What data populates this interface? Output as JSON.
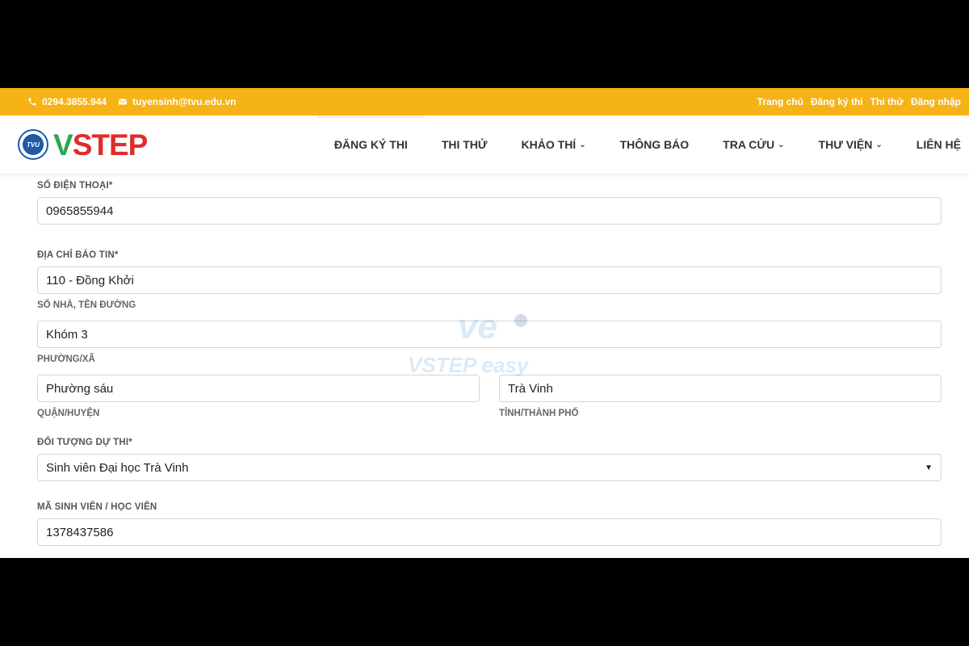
{
  "topbar": {
    "phone": "0294.3855.944",
    "email": "tuyensinh@tvu.edu.vn",
    "links": [
      "Trang chủ",
      "Đăng ký thi",
      "Thi thử",
      "Đăng nhập"
    ]
  },
  "header": {
    "logo_seal_text": "TVU",
    "brand_v": "V",
    "brand_rest": "STEP",
    "nav": [
      {
        "label": "ĐĂNG KÝ THI",
        "dropdown": false
      },
      {
        "label": "THI THỬ",
        "dropdown": false
      },
      {
        "label": "KHẢO THÍ",
        "dropdown": true
      },
      {
        "label": "THÔNG BÁO",
        "dropdown": false
      },
      {
        "label": "TRA CỨU",
        "dropdown": true
      },
      {
        "label": "THƯ VIỆN",
        "dropdown": true
      },
      {
        "label": "LIÊN HỆ",
        "dropdown": false
      }
    ]
  },
  "form": {
    "phone_label": "SỐ ĐIỆN THOẠI*",
    "phone_value": "0965855944",
    "address_label": "ĐỊA CHỈ BÁO TIN*",
    "street_value": "110 - Đồng Khởi",
    "street_hint": "SỐ NHÀ, TÊN ĐƯỜNG",
    "ward_value": "Khóm 3",
    "ward_hint": "PHƯỜNG/XÃ",
    "district_value": "Phường sáu",
    "district_hint": "QUẬN/HUYỆN",
    "province_value": "Trà Vinh",
    "province_hint": "TỈNH/THÀNH PHỐ",
    "candidate_label": "ĐỐI TƯỢNG DỰ THI*",
    "candidate_value": "Sinh viên Đại học Trà Vinh",
    "student_id_label": "MÃ SINH VIÊN / HỌC VIÊN",
    "student_id_value": "1378437586"
  },
  "watermark": {
    "text": "VSTEP easy"
  },
  "colors": {
    "topbar": "#f5b315",
    "brand_green": "#2ca84a",
    "brand_red": "#e22b2b"
  }
}
